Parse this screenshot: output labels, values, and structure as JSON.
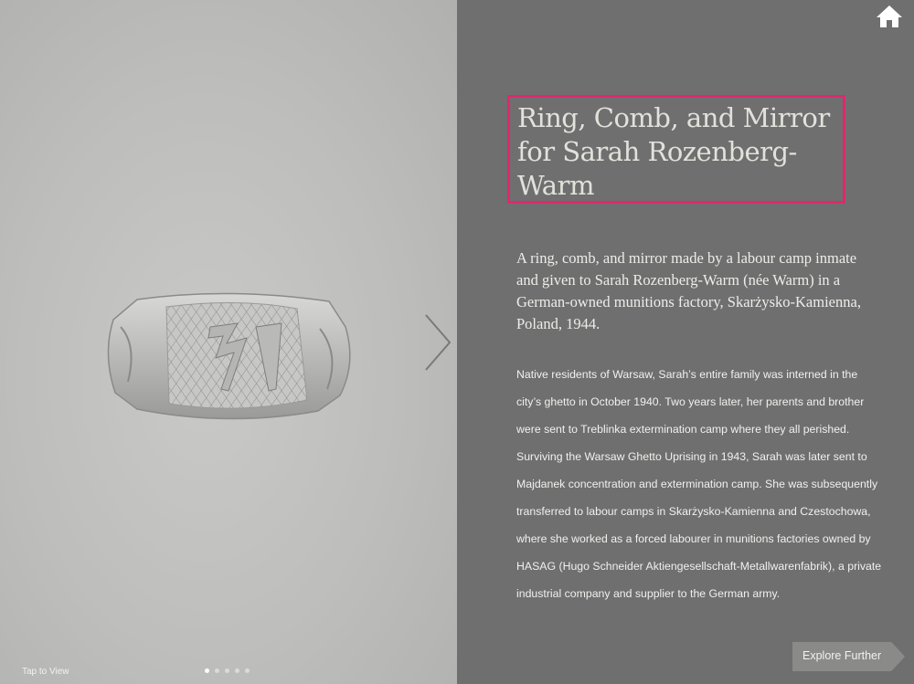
{
  "left_panel": {
    "tap_label": "Tap to View",
    "pagination": {
      "total": 5,
      "current": 1
    },
    "image_subject": "silver signet ring"
  },
  "article": {
    "title": "Ring, Comb, and Mirror for Sarah Rozenberg-Warm",
    "lead": "A ring, comb, and mirror made by a labour camp inmate and given to Sarah Rozenberg-Warm (née Warm) in a German-owned munitions factory, Skarżysko-Kamienna, Poland, 1944.",
    "body": "Native residents of Warsaw, Sarah’s entire family was interned in the city’s ghetto in October 1940. Two years later, her parents and brother were sent to Treblinka extermination camp where they all perished. Surviving the Warsaw Ghetto Uprising in 1943, Sarah was later sent to Majdanek concentration and extermination camp. She was subsequently transferred to labour camps in Skarżysko-Kamienna and Czestochowa, where she worked as a forced labourer in munitions factories owned by HASAG (Hugo Schneider Aktiengesellschaft-Metallwarenfabrik), a private industrial company and supplier to the German army."
  },
  "navigation": {
    "explore_label": "Explore Further",
    "next_icon": "chevron-right-icon",
    "home_icon": "home-icon"
  },
  "colors": {
    "highlight_border": "#e0286e",
    "panel_background": "#6f6f6f"
  }
}
